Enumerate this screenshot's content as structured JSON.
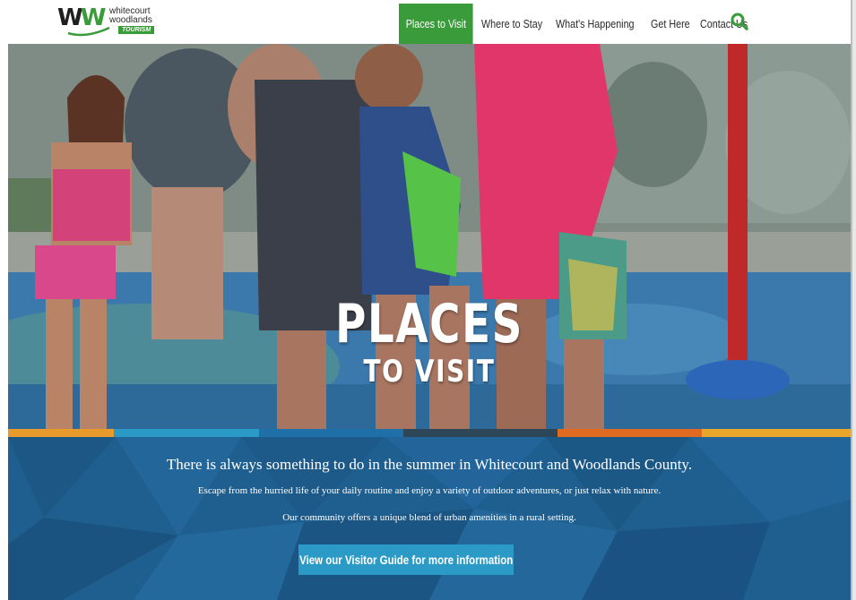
{
  "logo": {
    "mark": "WW",
    "line1": "whitecourt",
    "line2": "woodlands",
    "tag": "TOURISM"
  },
  "nav": {
    "items": [
      {
        "label": "Places to Visit",
        "active": true
      },
      {
        "label": "Where to Stay",
        "active": false
      },
      {
        "label": "What's Happening",
        "active": false
      },
      {
        "label": "Get Here",
        "active": false
      },
      {
        "label": "Contact Us",
        "active": false
      }
    ],
    "search_icon": "search-icon"
  },
  "hero": {
    "title_big": "PLACES",
    "title_small": "TO VISIT"
  },
  "stripe_colors": [
    "#e89a2a",
    "#2b9ac7",
    "#1f6fa8",
    "#2d4658",
    "#e06a1f",
    "#e8a62a"
  ],
  "info": {
    "heading": "There is always something to do in the summer in Whitecourt and Woodlands County.",
    "line1": "Escape from the hurried life of your daily routine and enjoy a variety of outdoor adventures, or just relax with nature.",
    "line2": "Our community offers a unique blend of urban amenities in a rural setting.",
    "button_label": "View our Visitor Guide for more information"
  },
  "colors": {
    "brand_green": "#3a9b3a",
    "panel_blue": "#1f5f8f",
    "button_blue": "#2b9ac7"
  }
}
